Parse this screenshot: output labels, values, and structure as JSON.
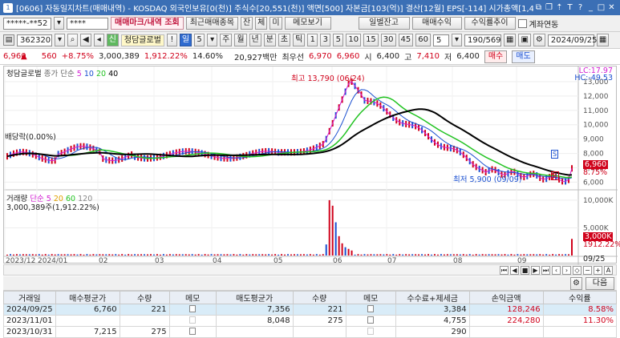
{
  "window": {
    "app_icon": "1",
    "title": "[0606] 자동일지차트(매매내역) - KOSDAQ 외국인보유[0(천)] 주식수[20,551(천)] 액면[500] 자본금[103(억)] 결산[12월] EPS[-114] 시가총액[1,4"
  },
  "toolbar1": {
    "account": "*****-**52",
    "password": "****",
    "trade_mark_btn": "매매마크/내역 조회",
    "recent_btn": "최근매매종목",
    "jan": "잔",
    "che": "체",
    "mi": "미",
    "memo_btn": "메모보기",
    "daily_balance_btn": "일별잔고",
    "trade_profit_btn": "매매수익",
    "profit_trend_btn": "수익률추이",
    "account_link_label": "계좌연동"
  },
  "toolbar2": {
    "code": "362320",
    "stock_name": "청담글로벌",
    "period_btns": [
      "일",
      "5",
      "주",
      "월",
      "년",
      "분",
      "초",
      "틱"
    ],
    "intervals": [
      "1",
      "3",
      "5",
      "10",
      "15",
      "30",
      "45",
      "60",
      "5"
    ],
    "count": "190/569",
    "date": "2024/09/25"
  },
  "quote": {
    "price": "6,960",
    "change": "560",
    "change_pct": "+8.75%",
    "volume": "3,000,389",
    "volume_ratio": "1,912.22%",
    "turnover": "14.60%",
    "amount": "20,927백만",
    "best_ask_label": "최우선",
    "best_ask": "6,970",
    "best_bid": "6,960",
    "open_label": "시",
    "open": "6,400",
    "high_label": "고",
    "high": "7,410",
    "low_label": "저",
    "low": "6,400",
    "buy_btn": "매수",
    "sell_btn": "매도"
  },
  "price_chart": {
    "legend_name": "청담글로벌",
    "legend_ma": "종가 단순",
    "ma_periods": [
      "5",
      "10",
      "20",
      "40"
    ],
    "lc": "LC:17.97",
    "hc": "HC:-49.53",
    "yticks": [
      "13,000",
      "12,000",
      "11,000",
      "10,000",
      "9,000",
      "8,000",
      "7,000",
      "6,000"
    ],
    "high_note": "최고 13,790 (06/24)",
    "low_note": "최저 5,900 (09/09)",
    "ex_dividend_note": "배당락(0.00%)",
    "last_price_tag": "6,960",
    "last_pct_tag": "8.75%",
    "marker_s": "S",
    "marker_b": "B"
  },
  "volume_chart": {
    "legend_name": "거래량",
    "legend_ma": "단순",
    "ma_periods": [
      "5",
      "20",
      "60",
      "120"
    ],
    "current": "3,000,389주(1,912.22%)",
    "yticks": [
      "10,000K",
      "5,000K"
    ],
    "last_tag": "3,000K",
    "last_pct_tag": "1912.22%"
  },
  "xaxis": {
    "labels": [
      "2023/12",
      "2024/01",
      "02",
      "03",
      "04",
      "05",
      "06",
      "07",
      "08",
      "09"
    ],
    "end_label": "09/25"
  },
  "table_toolbar": {
    "next_btn": "다음"
  },
  "table": {
    "headers": [
      "거래일",
      "매수평균가",
      "수량",
      "메모",
      "매도평균가",
      "수량",
      "메모",
      "수수료+제세금",
      "손익금액",
      "수익률"
    ],
    "rows": [
      {
        "date": "2024/09/25",
        "buy_avg": "6,760",
        "buy_qty": "221",
        "sell_avg": "7,356",
        "sell_qty": "221",
        "fee": "3,384",
        "pnl": "128,246",
        "rate": "8.58%"
      },
      {
        "date": "2023/11/01",
        "buy_avg": "",
        "buy_qty": "",
        "sell_avg": "8,048",
        "sell_qty": "275",
        "fee": "4,755",
        "pnl": "224,280",
        "rate": "11.30%"
      },
      {
        "date": "2023/10/31",
        "buy_avg": "7,215",
        "buy_qty": "275",
        "sell_avg": "",
        "sell_qty": "",
        "fee": "290",
        "pnl": "",
        "rate": ""
      }
    ]
  },
  "colors": {
    "up": "#d0021b",
    "down": "#1a4fd0",
    "ma5": "#d21fd2",
    "ma10": "#1a4fd0",
    "ma20": "#22c322",
    "ma40": "#000000"
  }
}
